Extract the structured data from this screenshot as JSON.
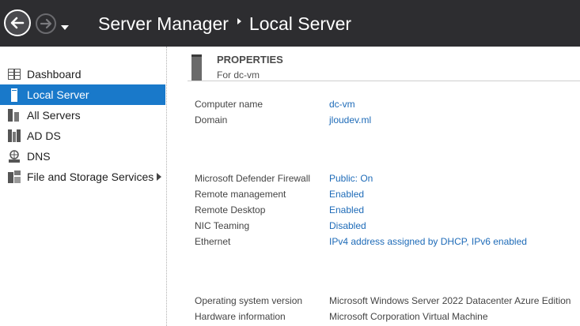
{
  "header": {
    "title_root": "Server Manager",
    "title_page": "Local Server"
  },
  "sidebar": {
    "items": [
      {
        "label": "Dashboard",
        "icon": "dashboard-icon"
      },
      {
        "label": "Local Server",
        "icon": "server-icon",
        "active": true
      },
      {
        "label": "All Servers",
        "icon": "servers-icon"
      },
      {
        "label": "AD DS",
        "icon": "ad-ds-icon"
      },
      {
        "label": "DNS",
        "icon": "dns-icon"
      },
      {
        "label": "File and Storage Services",
        "icon": "storage-icon",
        "has_submenu": true
      }
    ]
  },
  "properties": {
    "title": "PROPERTIES",
    "subtitle": "For dc-vm",
    "rows": [
      {
        "label": "Computer name",
        "value": "dc-vm"
      },
      {
        "label": "Domain",
        "value": "jloudev.ml"
      },
      {
        "label": "Microsoft Defender Firewall",
        "value": "Public: On"
      },
      {
        "label": "Remote management",
        "value": "Enabled"
      },
      {
        "label": "Remote Desktop",
        "value": "Enabled"
      },
      {
        "label": "NIC Teaming",
        "value": "Disabled"
      },
      {
        "label": "Ethernet",
        "value": "IPv4 address assigned by DHCP, IPv6 enabled"
      },
      {
        "label": "Operating system version",
        "value": "Microsoft Windows Server 2022 Datacenter Azure Edition"
      },
      {
        "label": "Hardware information",
        "value": "Microsoft Corporation Virtual Machine"
      }
    ]
  },
  "colors": {
    "header_bg": "#2d2d30",
    "accent": "#1979ca",
    "link": "#1e6bb8"
  }
}
